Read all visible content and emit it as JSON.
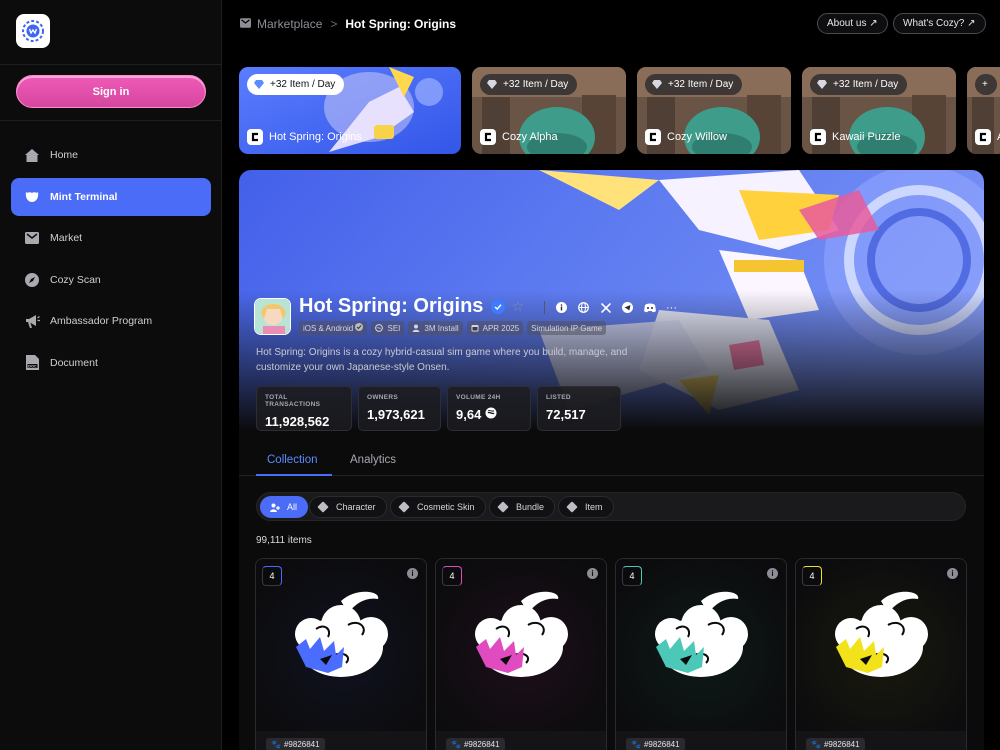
{
  "app": {
    "sign_in_label": "Sign in"
  },
  "sidebar": {
    "items": [
      {
        "label": "Home",
        "icon": "home-icon"
      },
      {
        "label": "Mint Terminal",
        "icon": "mint-icon"
      },
      {
        "label": "Market",
        "icon": "market-icon"
      },
      {
        "label": "Cozy Scan",
        "icon": "compass-icon"
      },
      {
        "label": "Ambassador Program",
        "icon": "megaphone-icon"
      },
      {
        "label": "Document",
        "icon": "document-icon"
      }
    ],
    "active_index": 1
  },
  "header": {
    "breadcrumb": [
      "Marketplace",
      "Hot Spring: Origins"
    ],
    "separator": ">",
    "about_label": "About us ↗",
    "whats_label": "What's Cozy? ↗"
  },
  "game_cards": [
    {
      "pill": "+32 Item / Day",
      "name": "Hot Spring: Origins"
    },
    {
      "pill": "+32 Item / Day",
      "name": "Cozy Alpha"
    },
    {
      "pill": "+32 Item / Day",
      "name": "Cozy Willow"
    },
    {
      "pill": "+32 Item / Day",
      "name": "Kawaii Puzzle"
    },
    {
      "pill": "+",
      "name": "A"
    }
  ],
  "game": {
    "title": "Hot Spring: Origins",
    "tags": [
      "iOS & Android",
      "SEI",
      "3M Install",
      "APR 2025",
      "Simulation IP Game"
    ],
    "description": "Hot Spring: Origins is a cozy hybrid-casual sim game where you build, manage, and customize your own Japanese-style Onsen.",
    "stats": [
      {
        "label": "TOTAL TRANSACTIONS",
        "value": "11,928,562"
      },
      {
        "label": "OWNERS",
        "value": "1,973,621"
      },
      {
        "label": "VOLUME 24H",
        "value": "9,64"
      },
      {
        "label": "LISTED",
        "value": "72,517"
      }
    ],
    "more": "···"
  },
  "tabs": [
    "Collection",
    "Analytics"
  ],
  "filters": [
    "All",
    "Character",
    "Cosmetic Skin",
    "Bundle",
    "Item"
  ],
  "items_count": "99,111 items",
  "items": [
    {
      "level": "4",
      "id": "#9826841",
      "color": "#4a6cff",
      "bg": "#101220"
    },
    {
      "level": "4",
      "id": "#9826841",
      "color": "#e04cc0",
      "bg": "#1e0f1a"
    },
    {
      "level": "4",
      "id": "#9826841",
      "color": "#4cc8b8",
      "bg": "#0e1a18"
    },
    {
      "level": "4",
      "id": "#9826841",
      "color": "#f2e21a",
      "bg": "#1a1a0e"
    }
  ],
  "colors": {
    "accent": "#4a6cf7",
    "signin": "#e24fae"
  }
}
